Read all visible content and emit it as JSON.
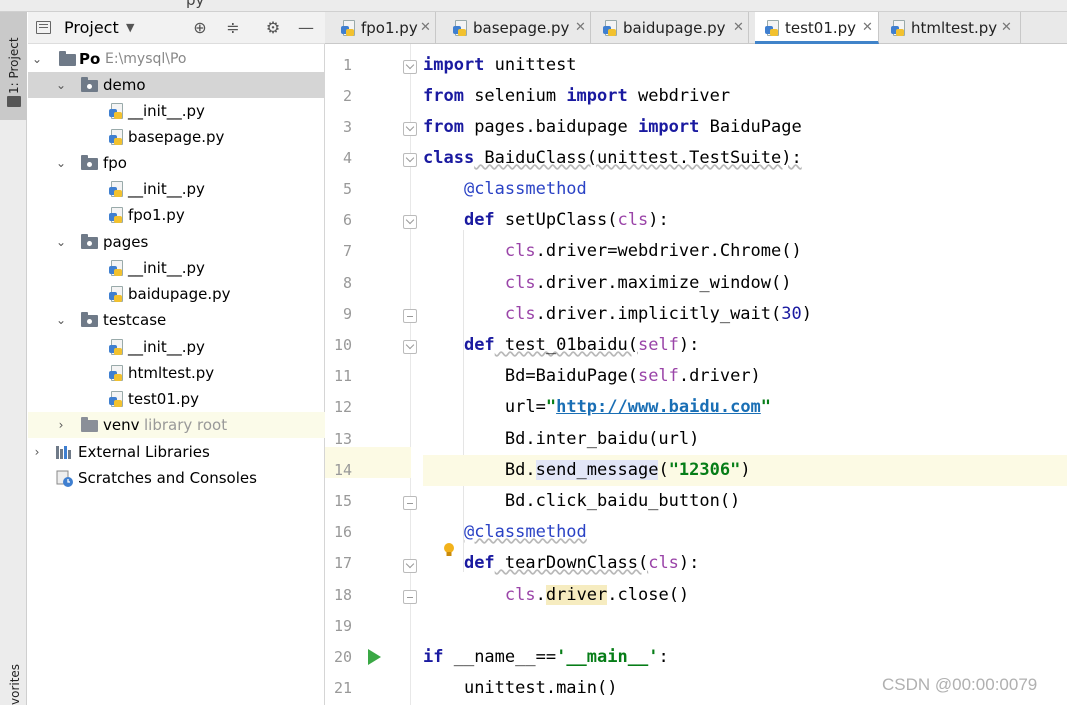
{
  "window": {
    "top_tab_partial": "py"
  },
  "tool_strip": {
    "project_label": "1: Project",
    "favorites_label": "vorites"
  },
  "project_panel": {
    "title": "Project",
    "tree": [
      {
        "label": "Po",
        "path": "E:\\mysql\\Po"
      },
      {
        "label": "demo"
      },
      {
        "label": "__init__.py"
      },
      {
        "label": "basepage.py"
      },
      {
        "label": "fpo"
      },
      {
        "label": "__init__.py"
      },
      {
        "label": "fpo1.py"
      },
      {
        "label": "pages"
      },
      {
        "label": "__init__.py"
      },
      {
        "label": "baidupage.py"
      },
      {
        "label": "testcase"
      },
      {
        "label": "__init__.py"
      },
      {
        "label": "htmltest.py"
      },
      {
        "label": "test01.py"
      },
      {
        "label": "venv",
        "note": "library root"
      },
      {
        "label": "External Libraries"
      },
      {
        "label": "Scratches and Consoles"
      }
    ]
  },
  "tabs": [
    {
      "label": "fpo1.py"
    },
    {
      "label": "basepage.py"
    },
    {
      "label": "baidupage.py"
    },
    {
      "label": "test01.py"
    },
    {
      "label": "htmltest.py"
    }
  ],
  "active_tab": "test01.py",
  "line_numbers": [
    "1",
    "2",
    "3",
    "4",
    "5",
    "6",
    "7",
    "8",
    "9",
    "10",
    "11",
    "12",
    "13",
    "14",
    "15",
    "16",
    "17",
    "18",
    "19",
    "20",
    "21"
  ],
  "code": {
    "l1": {
      "k1": "import",
      "t1": " unittest"
    },
    "l2": {
      "k1": "from",
      "t1": " selenium ",
      "k2": "import",
      "t2": " webdriver"
    },
    "l3": {
      "k1": "from",
      "t1": " pages.baidupage ",
      "k2": "import",
      "t2": " BaiduPage"
    },
    "l4": {
      "k1": "class",
      "t1": " BaiduClass(unittest.TestSuite):"
    },
    "l5": {
      "indent": "    ",
      "dec": "@classmethod"
    },
    "l6": {
      "indent": "    ",
      "k1": "def",
      "t1": " setUpClass(",
      "s1": "cls",
      "t2": "):"
    },
    "l7": {
      "indent": "        ",
      "s1": "cls",
      "t1": ".driver=webdriver.Chrome()"
    },
    "l8": {
      "indent": "        ",
      "s1": "cls",
      "t1": ".driver.maximize_window()"
    },
    "l9": {
      "indent": "        ",
      "s1": "cls",
      "t1": ".driver.implicitly_wait(",
      "n1": "30",
      "t2": ")"
    },
    "l10": {
      "indent": "    ",
      "k1": "def",
      "t1": " test_01baidu(",
      "s1": "self",
      "t2": "):"
    },
    "l11": {
      "indent": "        ",
      "t1": "Bd=BaiduPage(",
      "s1": "self",
      "t2": ".driver)"
    },
    "l12": {
      "indent": "        ",
      "t1": "url=",
      "q1": "\"",
      "u1": "http://www.baidu.com",
      "q2": "\""
    },
    "l13": {
      "indent": "        ",
      "t1": "Bd.inter_baidu(url)"
    },
    "l14": {
      "indent": "        ",
      "t1": "Bd.",
      "m1": "send_message",
      "t2": "(",
      "st": "\"12306\"",
      "t3": ")"
    },
    "l15": {
      "indent": "        ",
      "t1": "Bd.click_baidu_button()"
    },
    "l16": {
      "indent": "    ",
      "dec": "@classmethod"
    },
    "l17": {
      "indent": "    ",
      "k1": "def",
      "t1": " tearDownClass(",
      "s1": "cls",
      "t2": "):"
    },
    "l18": {
      "indent": "        ",
      "s1": "cls",
      "t1": ".",
      "y1": "driver",
      "t2": ".close()"
    },
    "l20": {
      "k1": "if",
      "t1": " __name__==",
      "st": "'__main__'",
      "t2": ":"
    },
    "l21": {
      "indent": "    ",
      "t1": "unittest.main()"
    }
  },
  "watermark": "CSDN @00:00:0079",
  "colors": {
    "keyword": "#1a1aa0",
    "string": "#067d17",
    "self": "#9a44a8",
    "active_tab_underline": "#4083c9",
    "caret_line": "#fcfae4"
  }
}
